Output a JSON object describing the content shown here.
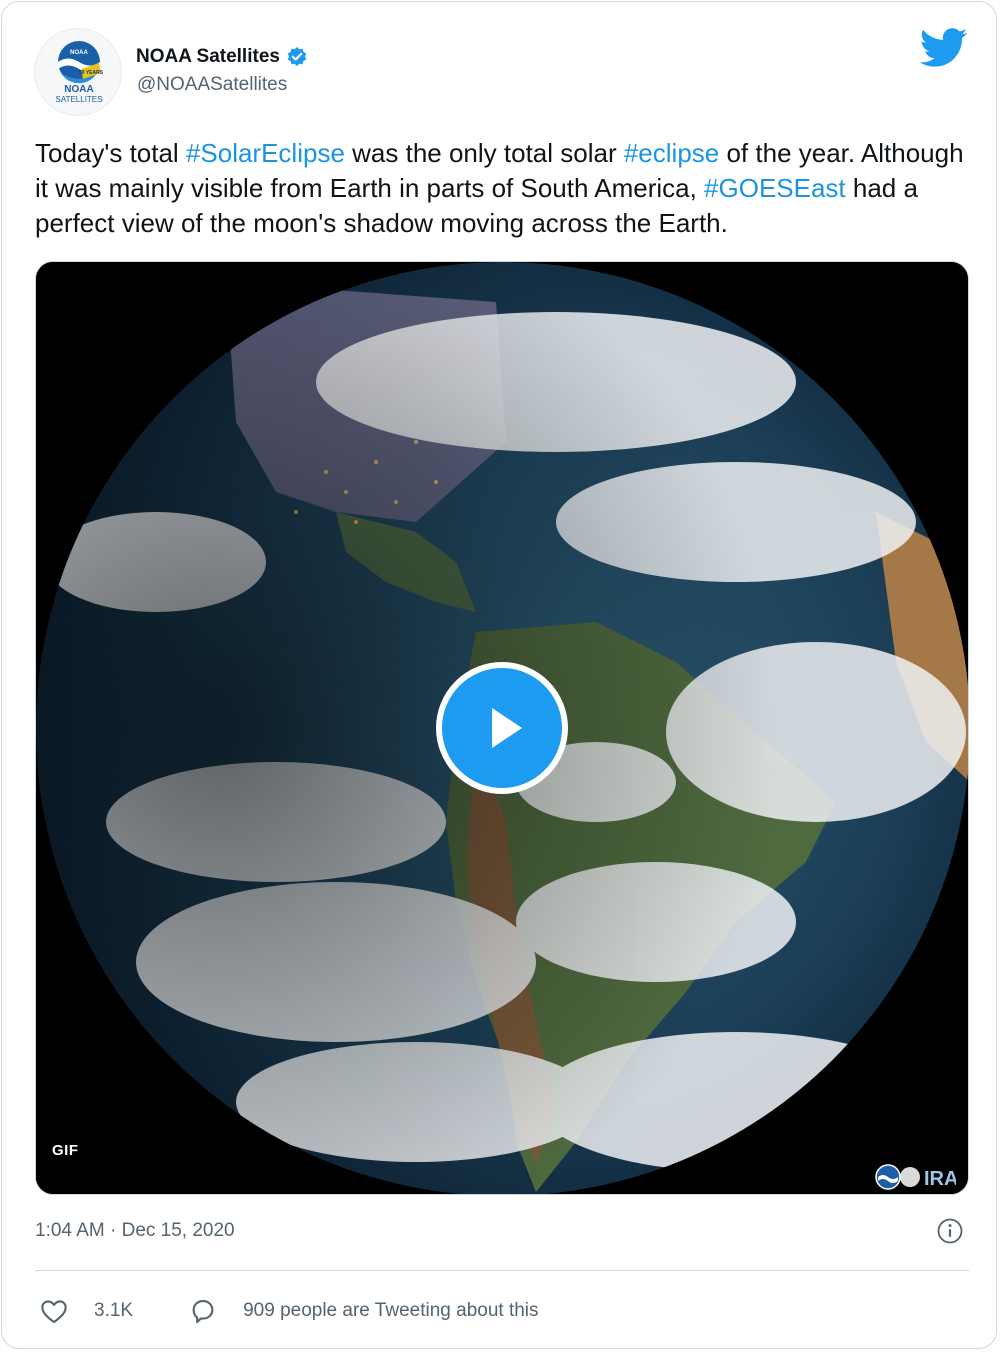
{
  "account": {
    "display_name": "NOAA Satellites",
    "handle": "@NOAASatellites",
    "avatar_logo": {
      "top_text": "NOAA",
      "ribbon_text": "50 YEARS",
      "line1": "NOAA",
      "line2": "SATELLITES"
    },
    "verified_icon": "verified-badge-icon",
    "brand_icon": "twitter-bird-icon"
  },
  "tweet": {
    "text_segments": [
      {
        "text": "Today's total ",
        "type": "text"
      },
      {
        "text": "#SolarEclipse",
        "type": "hashtag"
      },
      {
        "text": " was the only total solar ",
        "type": "text"
      },
      {
        "text": "#eclipse",
        "type": "hashtag"
      },
      {
        "text": " of the year. Although it was mainly visible from Earth in parts of South America, ",
        "type": "text"
      },
      {
        "text": "#GOESEast",
        "type": "hashtag"
      },
      {
        "text": " had a perfect view of the moon's shadow moving across the Earth.",
        "type": "text"
      }
    ]
  },
  "media": {
    "type": "GIF",
    "badge": "GIF",
    "play_icon": "play-icon",
    "watermark_text": "IRA"
  },
  "meta": {
    "timestamp": "1:04 AM · Dec 15, 2020",
    "info_icon": "info-icon"
  },
  "actions": {
    "like_count": "3.1K",
    "like_icon": "heart-icon",
    "reply_text": "909 people are Tweeting about this",
    "reply_icon": "speech-bubble-icon"
  },
  "colors": {
    "hashtag": "#1b95e0",
    "brand": "#1d9bf0",
    "muted": "#536471",
    "border": "#cfd9de"
  }
}
